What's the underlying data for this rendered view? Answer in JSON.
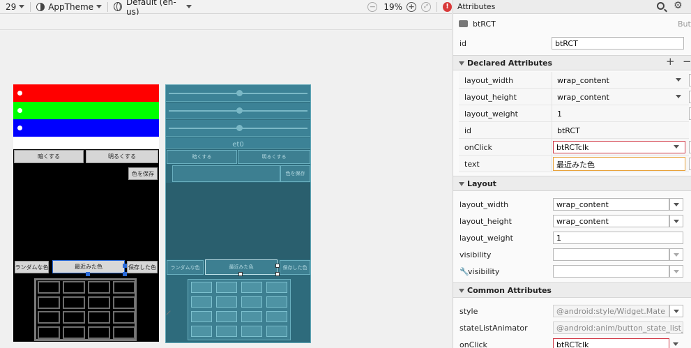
{
  "toolbar": {
    "api_level": "29",
    "theme": "AppTheme",
    "locale": "Default (en-us)",
    "zoom": "19%",
    "zoom_out": "−",
    "zoom_in": "+",
    "error_icon": "!"
  },
  "design": {
    "color_strips": [
      "#ff0000",
      "#00ff00",
      "#0000ff",
      "#ffffff"
    ],
    "buttons": {
      "darken": "暗くする",
      "lighten": "明るくする",
      "save_color": "色を保存",
      "random": "ランダムな色",
      "recent": "最近みた色",
      "saved": "保存した色"
    },
    "grid": {
      "rows": 4,
      "cols": 4
    }
  },
  "blueprint": {
    "et0": "et0",
    "darken": "暗くする",
    "lighten": "明るくする",
    "save_color": "色を保存",
    "random": "ランダムな色",
    "recent": "最近みた色",
    "saved": "保存した色"
  },
  "panel": {
    "title": "Attributes",
    "component": {
      "name": "btRCT",
      "type": "Butt"
    },
    "id": {
      "label": "id",
      "value": "btRCT"
    },
    "declared": {
      "title": "Declared Attributes",
      "rows": [
        {
          "label": "layout_width",
          "value": "wrap_content"
        },
        {
          "label": "layout_height",
          "value": "wrap_content"
        },
        {
          "label": "layout_weight",
          "value": "1"
        },
        {
          "label": "id",
          "value": "btRCT"
        },
        {
          "label": "onClick",
          "value": "btRCTclk"
        },
        {
          "label": "text",
          "value": "最近みた色"
        }
      ]
    },
    "layout": {
      "title": "Layout",
      "rows": [
        {
          "label": "layout_width",
          "value": "wrap_content"
        },
        {
          "label": "layout_height",
          "value": "wrap_content"
        },
        {
          "label": "layout_weight",
          "value": "1"
        },
        {
          "label": "visibility",
          "value": ""
        },
        {
          "label": "visibility",
          "value": ""
        }
      ]
    },
    "common": {
      "title": "Common Attributes",
      "rows": [
        {
          "label": "style",
          "value": "@android:style/Widget.Mate"
        },
        {
          "label": "stateListAnimator",
          "value": "@android:anim/button_state_list_a"
        },
        {
          "label": "onClick",
          "value": "btRCTclk"
        }
      ]
    }
  }
}
